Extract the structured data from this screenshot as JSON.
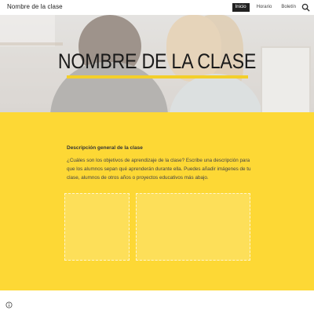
{
  "header": {
    "site_title": "Nombre de la clase",
    "nav": [
      {
        "label": "Inicio",
        "active": true
      },
      {
        "label": "Horario",
        "active": false
      },
      {
        "label": "Boletín",
        "active": false
      }
    ],
    "search_icon": "search-icon"
  },
  "hero": {
    "title": "NOMBRE DE LA CLASE",
    "accent_color": "#f3cf2a"
  },
  "section": {
    "heading": "Descripción general de la clase",
    "body": "¿Cuáles son los objetivos de aprendizaje de la clase? Escribe una descripción para que los alumnos sepan qué aprenderán durante ella. Puedes añadir imágenes de tu clase, alumnos de otros años o proyectos educativos más abajo.",
    "background_color": "#fdd835"
  },
  "footer": {
    "info_icon": "info-icon"
  }
}
